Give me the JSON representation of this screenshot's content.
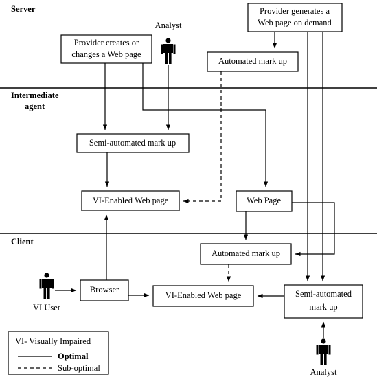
{
  "title": "Web accessibility mark-up workflow diagram",
  "sections": [
    {
      "id": "server",
      "label": "Server"
    },
    {
      "id": "intermediate",
      "label_line1": "Intermediate",
      "label_line2": "agent"
    },
    {
      "id": "client",
      "label": "Client"
    }
  ],
  "boxes": {
    "provider_creates": {
      "line1": "Provider  creates  or",
      "line2": "changes a Web page"
    },
    "provider_generates": {
      "line1": "Provider  generates  a",
      "line2": "Web page on demand"
    },
    "automated_markup_server": {
      "line1": "Automated mark up"
    },
    "semi_automated_markup_agent": {
      "line1": "Semi-automated mark up"
    },
    "vi_enabled_web_page_agent": {
      "line1": "VI-Enabled Web page"
    },
    "web_page_agent": {
      "line1": "Web Page"
    },
    "automated_markup_client": {
      "line1": "Automated mark up"
    },
    "browser": {
      "line1": "Browser"
    },
    "vi_enabled_web_page_client": {
      "line1": "VI-Enabled Web page"
    },
    "semi_automated_markup_client": {
      "line1": "Semi-automated",
      "line2": "mark up"
    }
  },
  "actors": {
    "analyst_server": {
      "label": "Analyst"
    },
    "vi_user": {
      "label": "VI User"
    },
    "analyst_client": {
      "label": "Analyst"
    }
  },
  "legend": {
    "abbreviation": "VI- Visually Impaired",
    "optimal": "Optimal",
    "suboptimal": "Sub-optimal"
  },
  "colors": {
    "stroke": "#000000",
    "background": "#ffffff"
  }
}
